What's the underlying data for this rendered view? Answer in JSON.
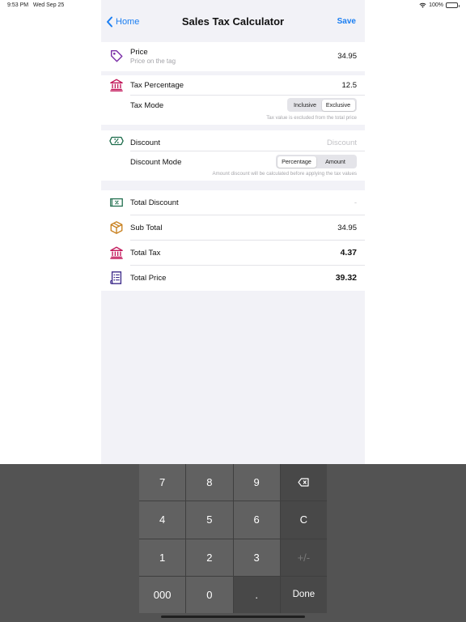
{
  "status": {
    "time": "9:53 PM",
    "date": "Wed Sep 25",
    "battery": "100%"
  },
  "nav": {
    "back_label": "Home",
    "title": "Sales Tax Calculator",
    "save_label": "Save"
  },
  "price": {
    "label": "Price",
    "sublabel": "Price on the tag",
    "value": "34.95"
  },
  "tax": {
    "label": "Tax Percentage",
    "value": "12.5",
    "mode_label": "Tax Mode",
    "mode_options": [
      "Inclusive",
      "Exclusive"
    ],
    "mode_selected": "Exclusive",
    "hint": "Tax value is excluded from the total price"
  },
  "discount": {
    "label": "Discount",
    "placeholder": "Discount",
    "mode_label": "Discount Mode",
    "mode_options": [
      "Percentage",
      "Amount"
    ],
    "mode_selected": "Percentage",
    "hint": "Amount discount will be calculated before applying the tax values"
  },
  "results": {
    "total_discount": {
      "label": "Total Discount",
      "value": "-"
    },
    "sub_total": {
      "label": "Sub Total",
      "value": "34.95"
    },
    "total_tax": {
      "label": "Total Tax",
      "value": "4.37"
    },
    "total_price": {
      "label": "Total Price",
      "value": "39.32"
    }
  },
  "keypad": {
    "keys": [
      "7",
      "8",
      "9",
      "⌫",
      "4",
      "5",
      "6",
      "C",
      "1",
      "2",
      "3",
      "+/-",
      "000",
      "0",
      ".",
      "Done"
    ]
  },
  "colors": {
    "accent": "#1a7ef2",
    "price_icon": "#7b2fa8",
    "tax_icon": "#c2185b",
    "discount_icon": "#1b6b4a",
    "subtotal_icon": "#c8801e",
    "total_price_icon": "#3d2a8a"
  },
  "icons": {
    "price": "price-tag-icon",
    "tax": "bank-icon",
    "discount": "discount-ticket-icon",
    "total_discount": "banknote-icon",
    "sub_total": "box-icon",
    "total_tax": "bank-icon",
    "total_price": "receipt-icon"
  }
}
